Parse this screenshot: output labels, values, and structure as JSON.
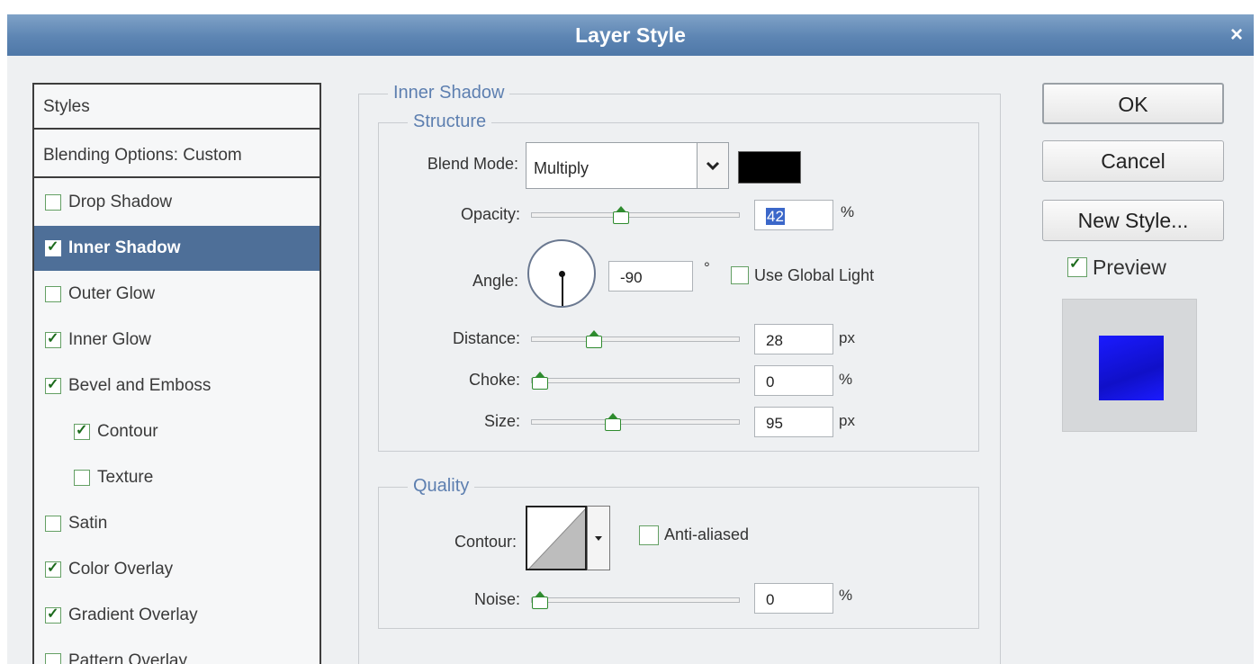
{
  "window": {
    "title": "Layer Style",
    "close_glyph": "×"
  },
  "styles_panel": {
    "header": "Styles",
    "blending": "Blending Options: Custom",
    "items": [
      {
        "label": "Drop Shadow",
        "checked": false,
        "selected": false,
        "indent": false
      },
      {
        "label": "Inner Shadow",
        "checked": true,
        "selected": true,
        "indent": false
      },
      {
        "label": "Outer Glow",
        "checked": false,
        "selected": false,
        "indent": false
      },
      {
        "label": "Inner Glow",
        "checked": true,
        "selected": false,
        "indent": false
      },
      {
        "label": "Bevel and Emboss",
        "checked": true,
        "selected": false,
        "indent": false
      },
      {
        "label": "Contour",
        "checked": true,
        "selected": false,
        "indent": true
      },
      {
        "label": "Texture",
        "checked": false,
        "selected": false,
        "indent": true
      },
      {
        "label": "Satin",
        "checked": false,
        "selected": false,
        "indent": false
      },
      {
        "label": "Color Overlay",
        "checked": true,
        "selected": false,
        "indent": false
      },
      {
        "label": "Gradient Overlay",
        "checked": true,
        "selected": false,
        "indent": false
      },
      {
        "label": "Pattern Overlay",
        "checked": false,
        "selected": false,
        "indent": false
      }
    ]
  },
  "inner_shadow": {
    "title": "Inner Shadow",
    "structure": {
      "title": "Structure",
      "blend_mode": {
        "label": "Blend Mode:",
        "value": "Multiply",
        "color": "#000000"
      },
      "opacity": {
        "label": "Opacity:",
        "value": "42",
        "unit": "%",
        "level": 0.42
      },
      "angle": {
        "label": "Angle:",
        "value": "-90",
        "unit": "°",
        "degrees": -90
      },
      "use_global_light": {
        "label": "Use Global Light",
        "checked": false
      },
      "distance": {
        "label": "Distance:",
        "value": "28",
        "unit": "px",
        "level": 0.28
      },
      "choke": {
        "label": "Choke:",
        "value": "0",
        "unit": "%",
        "level": 0.0
      },
      "size": {
        "label": "Size:",
        "value": "95",
        "unit": "px",
        "level": 0.38
      }
    },
    "quality": {
      "title": "Quality",
      "contour": {
        "label": "Contour:"
      },
      "anti_aliased": {
        "label": "Anti-aliased",
        "checked": false
      },
      "noise": {
        "label": "Noise:",
        "value": "0",
        "unit": "%",
        "level": 0.0
      }
    }
  },
  "buttons": {
    "ok": "OK",
    "cancel": "Cancel",
    "new_style": "New Style..."
  },
  "preview": {
    "label": "Preview",
    "checked": true,
    "swatch_color": "#1a1aff"
  }
}
